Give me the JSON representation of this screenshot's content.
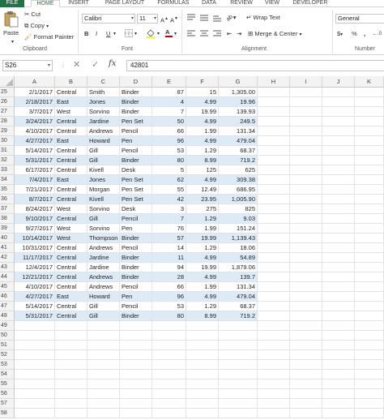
{
  "tabs": [
    {
      "label": "FILE",
      "active": false
    },
    {
      "label": "HOME",
      "active": true
    },
    {
      "label": "INSERT",
      "active": false
    },
    {
      "label": "PAGE LAYOUT",
      "active": false
    },
    {
      "label": "FORMULAS",
      "active": false
    },
    {
      "label": "DATA",
      "active": false
    },
    {
      "label": "REVIEW",
      "active": false
    },
    {
      "label": "VIEW",
      "active": false
    },
    {
      "label": "DEVELOPER",
      "active": false
    }
  ],
  "ribbon": {
    "paste": "Paste",
    "cut": "Cut",
    "copy": "Copy",
    "format_painter": "Format Painter",
    "clipboard": "Clipboard",
    "font_name": "Calibri",
    "font_size": "11",
    "font": "Font",
    "bold": "B",
    "italic": "I",
    "underline": "U",
    "wrap_text": "Wrap Text",
    "merge_center": "Merge & Center",
    "alignment": "Alignment",
    "number_format": "General",
    "currency": "$",
    "percent": "%",
    "comma": ",",
    "number": "Number",
    "font_color": "#c00000",
    "fill_color": "#ffff00",
    "accent": "#217346"
  },
  "formula_bar": {
    "name_box": "S26",
    "fx": "fx",
    "value": "42801"
  },
  "columns": [
    "A",
    "B",
    "C",
    "D",
    "E",
    "F",
    "G",
    "H",
    "I",
    "J",
    "K"
  ],
  "data_rows": [
    {
      "n": "25",
      "a": "2/1/2017",
      "b": "Central",
      "c": "Smith",
      "d": "Binder",
      "e": "87",
      "f": "15",
      "g": "1,305.00",
      "band": false
    },
    {
      "n": "26",
      "a": "2/18/2017",
      "b": "East",
      "c": "Jones",
      "d": "Binder",
      "e": "4",
      "f": "4.99",
      "g": "19.96",
      "band": true
    },
    {
      "n": "27",
      "a": "3/7/2017",
      "b": "West",
      "c": "Sorvino",
      "d": "Binder",
      "e": "7",
      "f": "19.99",
      "g": "139.93",
      "band": false
    },
    {
      "n": "28",
      "a": "3/24/2017",
      "b": "Central",
      "c": "Jardine",
      "d": "Pen Set",
      "e": "50",
      "f": "4.99",
      "g": "249.5",
      "band": true
    },
    {
      "n": "29",
      "a": "4/10/2017",
      "b": "Central",
      "c": "Andrews",
      "d": "Pencil",
      "e": "66",
      "f": "1.99",
      "g": "131.34",
      "band": false
    },
    {
      "n": "30",
      "a": "4/27/2017",
      "b": "East",
      "c": "Howard",
      "d": "Pen",
      "e": "96",
      "f": "4.99",
      "g": "479.04",
      "band": true
    },
    {
      "n": "31",
      "a": "5/14/2017",
      "b": "Central",
      "c": "Gill",
      "d": "Pencil",
      "e": "53",
      "f": "1.29",
      "g": "68.37",
      "band": false
    },
    {
      "n": "32",
      "a": "5/31/2017",
      "b": "Central",
      "c": "Gill",
      "d": "Binder",
      "e": "80",
      "f": "8.99",
      "g": "719.2",
      "band": true
    },
    {
      "n": "33",
      "a": "6/17/2017",
      "b": "Central",
      "c": "Kivell",
      "d": "Desk",
      "e": "5",
      "f": "125",
      "g": "625",
      "band": false
    },
    {
      "n": "34",
      "a": "7/4/2017",
      "b": "East",
      "c": "Jones",
      "d": "Pen Set",
      "e": "62",
      "f": "4.99",
      "g": "309.38",
      "band": true
    },
    {
      "n": "35",
      "a": "7/21/2017",
      "b": "Central",
      "c": "Morgan",
      "d": "Pen Set",
      "e": "55",
      "f": "12.49",
      "g": "686.95",
      "band": false
    },
    {
      "n": "36",
      "a": "8/7/2017",
      "b": "Central",
      "c": "Kivell",
      "d": "Pen Set",
      "e": "42",
      "f": "23.95",
      "g": "1,005.90",
      "band": true
    },
    {
      "n": "37",
      "a": "8/24/2017",
      "b": "West",
      "c": "Sorvino",
      "d": "Desk",
      "e": "3",
      "f": "275",
      "g": "825",
      "band": false
    },
    {
      "n": "38",
      "a": "9/10/2017",
      "b": "Central",
      "c": "Gill",
      "d": "Pencil",
      "e": "7",
      "f": "1.29",
      "g": "9.03",
      "band": true
    },
    {
      "n": "39",
      "a": "9/27/2017",
      "b": "West",
      "c": "Sorvino",
      "d": "Pen",
      "e": "76",
      "f": "1.99",
      "g": "151.24",
      "band": false
    },
    {
      "n": "40",
      "a": "10/14/2017",
      "b": "West",
      "c": "Thompson",
      "d": "Binder",
      "e": "57",
      "f": "19.99",
      "g": "1,139.43",
      "band": true
    },
    {
      "n": "41",
      "a": "10/31/2017",
      "b": "Central",
      "c": "Andrews",
      "d": "Pencil",
      "e": "14",
      "f": "1.29",
      "g": "18.06",
      "band": false
    },
    {
      "n": "42",
      "a": "11/17/2017",
      "b": "Central",
      "c": "Jardine",
      "d": "Binder",
      "e": "11",
      "f": "4.99",
      "g": "54.89",
      "band": true
    },
    {
      "n": "43",
      "a": "12/4/2017",
      "b": "Central",
      "c": "Jardine",
      "d": "Binder",
      "e": "94",
      "f": "19.99",
      "g": "1,879.06",
      "band": false
    },
    {
      "n": "44",
      "a": "12/21/2017",
      "b": "Central",
      "c": "Andrews",
      "d": "Binder",
      "e": "28",
      "f": "4.99",
      "g": "139.7",
      "band": true
    },
    {
      "n": "45",
      "a": "4/10/2017",
      "b": "Central",
      "c": "Andrews",
      "d": "Pencil",
      "e": "66",
      "f": "1.99",
      "g": "131.34",
      "band": false
    },
    {
      "n": "46",
      "a": "4/27/2017",
      "b": "East",
      "c": "Howard",
      "d": "Pen",
      "e": "96",
      "f": "4.99",
      "g": "479.04",
      "band": true
    },
    {
      "n": "47",
      "a": "5/14/2017",
      "b": "Central",
      "c": "Gill",
      "d": "Pencil",
      "e": "53",
      "f": "1.29",
      "g": "68.37",
      "band": false
    },
    {
      "n": "48",
      "a": "5/31/2017",
      "b": "Central",
      "c": "Gill",
      "d": "Binder",
      "e": "80",
      "f": "8.99",
      "g": "719.2",
      "band": true
    }
  ],
  "empty_rows": [
    "49",
    "50",
    "51",
    "52",
    "53",
    "54",
    "55",
    "56",
    "57",
    "58"
  ]
}
